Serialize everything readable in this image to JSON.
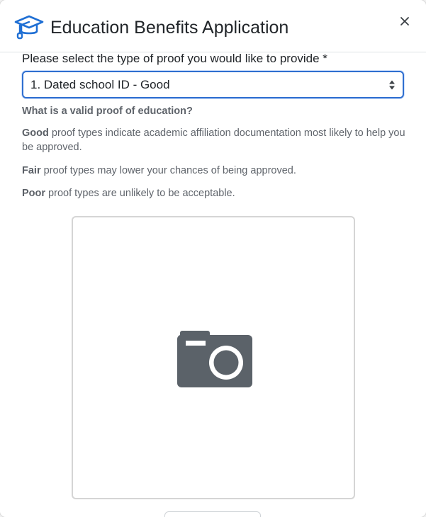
{
  "modal": {
    "title": "Education Benefits Application",
    "close_label": "×"
  },
  "form": {
    "proof_type_label": "Please select the type of proof you would like to provide *",
    "proof_type_selected": "1. Dated school ID - Good"
  },
  "help": {
    "heading": "What is a valid proof of education?",
    "good_strong": "Good",
    "good_text": " proof types indicate academic affiliation documentation most likely to help you be approved.",
    "fair_strong": "Fair",
    "fair_text": " proof types may lower your chances of being approved.",
    "poor_strong": "Poor",
    "poor_text": " proof types are unlikely to be acceptable."
  },
  "icons": {
    "header": "graduation-cap-icon",
    "close": "close-icon",
    "select": "sort-arrows-icon",
    "photo": "camera-icon"
  },
  "colors": {
    "accent": "#1f6fd4",
    "icon_gray": "#5b6269",
    "text_muted": "#5f646b"
  }
}
